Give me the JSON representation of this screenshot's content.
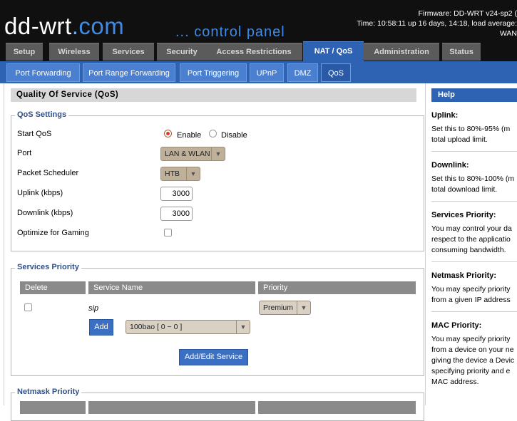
{
  "header": {
    "logo_main": "dd-wrt",
    "logo_dot": ".",
    "logo_com": "com",
    "panel_title": "... control panel",
    "firmware": "Firmware: DD-WRT v24-sp2 (",
    "time": "Time: 10:58:11 up 16 days, 14:18, load average:",
    "wan": "WAN"
  },
  "main_tabs": [
    "Setup",
    "Wireless",
    "Services",
    "Security",
    "Access Restrictions",
    "NAT / QoS",
    "Administration",
    "Status"
  ],
  "main_tabs_active": "NAT / QoS",
  "sub_tabs": [
    "Port Forwarding",
    "Port Range Forwarding",
    "Port Triggering",
    "UPnP",
    "DMZ",
    "QoS"
  ],
  "sub_tabs_active": "QoS",
  "page_title": "Quality Of Service (QoS)",
  "qos_settings": {
    "legend": "QoS Settings",
    "start_qos_label": "Start QoS",
    "enable_label": "Enable",
    "disable_label": "Disable",
    "start_qos_value": "Enable",
    "port_label": "Port",
    "port_value": "LAN & WLAN",
    "scheduler_label": "Packet Scheduler",
    "scheduler_value": "HTB",
    "uplink_label": "Uplink (kbps)",
    "uplink_value": "3000",
    "downlink_label": "Downlink (kbps)",
    "downlink_value": "3000",
    "gaming_label": "Optimize for Gaming",
    "gaming_checked": false
  },
  "services_priority": {
    "legend": "Services Priority",
    "columns": [
      "Delete",
      "Service Name",
      "Priority"
    ],
    "rows": [
      {
        "name": "sip",
        "priority": "Premium"
      }
    ],
    "add_button": "Add",
    "service_select_value": "100bao [ 0 ~ 0 ]",
    "add_edit_button": "Add/Edit Service"
  },
  "netmask_priority": {
    "legend": "Netmask Priority"
  },
  "help": {
    "title": "Help",
    "sections": [
      {
        "heading": "Uplink:",
        "lines": [
          "Set this to 80%-95% (m",
          "total upload limit."
        ]
      },
      {
        "heading": "Downlink:",
        "lines": [
          "Set this to 80%-100% (m",
          "total download limit."
        ]
      },
      {
        "heading": "Services Priority:",
        "lines": [
          "You may control your da",
          "respect to the applicatio",
          "consuming bandwidth."
        ]
      },
      {
        "heading": "Netmask Priority:",
        "lines": [
          "You may specify priority",
          "from a given IP address"
        ]
      },
      {
        "heading": "MAC Priority:",
        "lines": [
          "You may specify priority",
          "from a device on your ne",
          "giving the device a Devic",
          "specifying priority and e",
          "MAC address."
        ]
      }
    ]
  },
  "colors": {
    "accent": "#2e63b4",
    "header_bg": "#101010",
    "inactive_tab": "#5b5b5b",
    "table_header": "#8a8a8a",
    "select_bg": "#bfb09a"
  }
}
